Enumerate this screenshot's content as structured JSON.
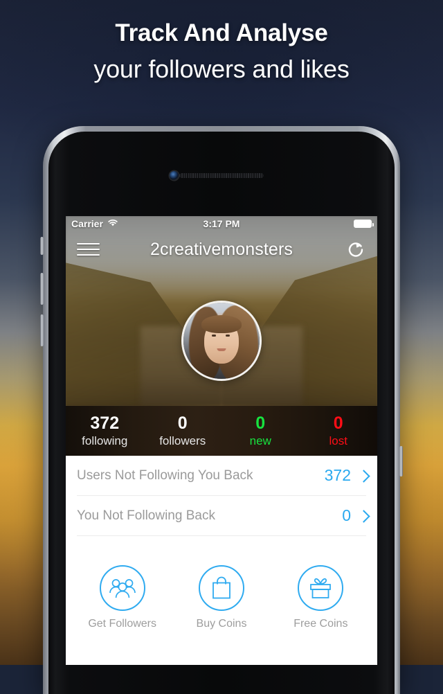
{
  "promo": {
    "headline_line1": "Track And Analyse",
    "headline_line2": "your followers and likes"
  },
  "status_bar": {
    "carrier": "Carrier",
    "time": "3:17 PM",
    "wifi_icon": "wifi-icon",
    "battery_icon": "battery-full-icon"
  },
  "navbar": {
    "menu_icon": "hamburger-menu-icon",
    "title": "2creativemonsters",
    "refresh_icon": "refresh-icon"
  },
  "profile": {
    "avatar_icon": "user-avatar",
    "cover_photo": "mountain-lake-landscape"
  },
  "stats": [
    {
      "value": "372",
      "label": "following",
      "color": "#ffffff"
    },
    {
      "value": "0",
      "label": "followers",
      "color": "#ffffff"
    },
    {
      "value": "0",
      "label": "new",
      "color": "#17e23f"
    },
    {
      "value": "0",
      "label": "lost",
      "color": "#ff0d16"
    }
  ],
  "list_rows": [
    {
      "label": "Users Not Following You Back",
      "value": "372",
      "chevron_icon": "chevron-right-icon"
    },
    {
      "label": "You Not Following Back",
      "value": "0",
      "chevron_icon": "chevron-right-icon"
    }
  ],
  "actions": [
    {
      "label": "Get Followers",
      "icon": "users-group-icon"
    },
    {
      "label": "Buy Coins",
      "icon": "shopping-bag-icon"
    },
    {
      "label": "Free Coins",
      "icon": "gift-box-icon"
    }
  ],
  "colors": {
    "accent": "#2aa9ef",
    "accent_icon": "#2fabf0",
    "stat_new": "#17e23f",
    "stat_lost": "#ff0d16",
    "muted_text": "#9a9a9a"
  }
}
